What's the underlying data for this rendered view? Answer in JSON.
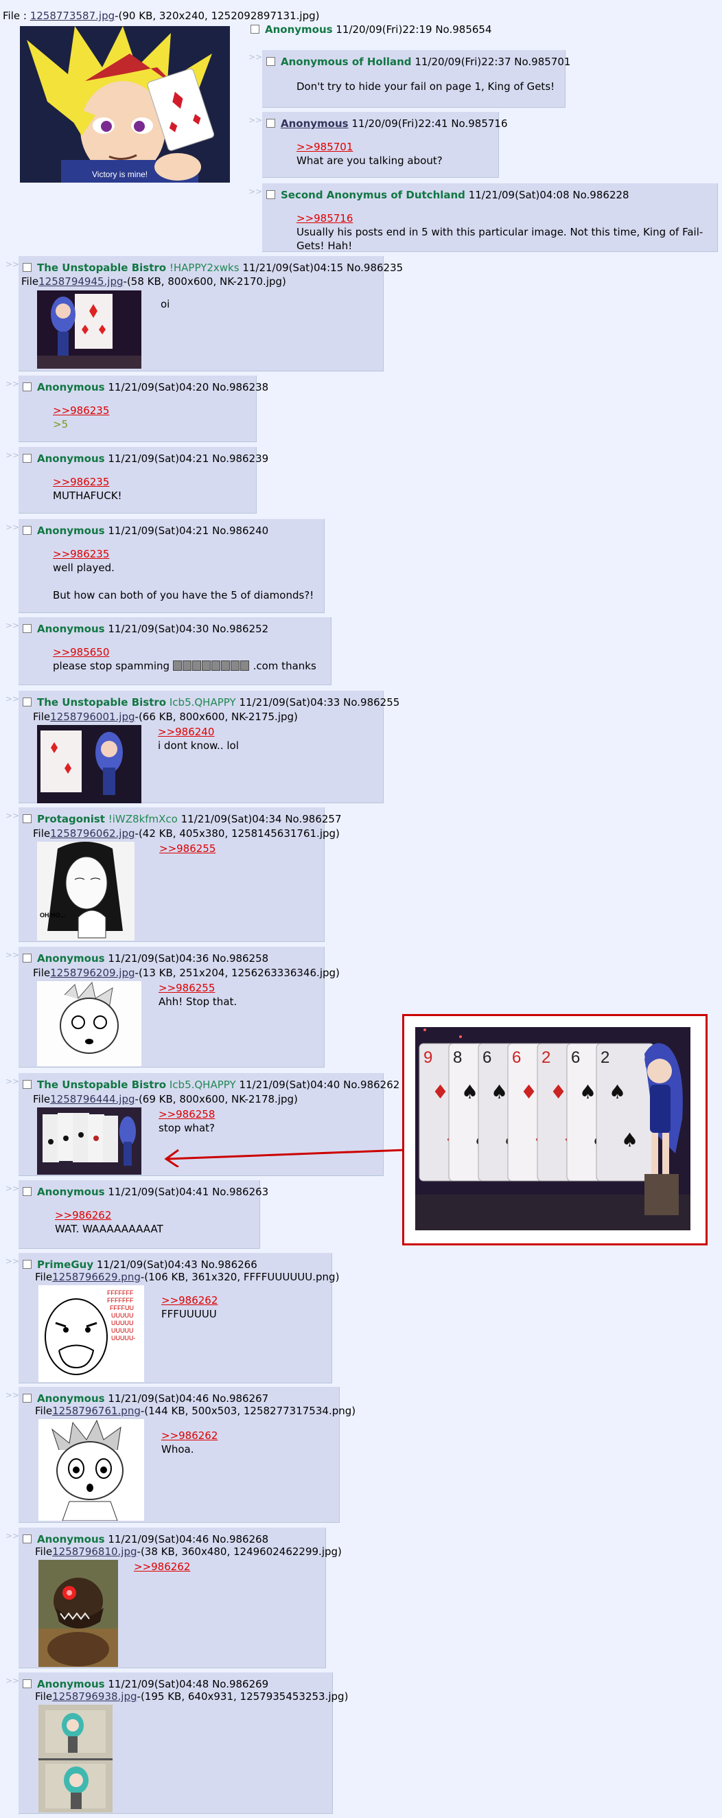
{
  "op": {
    "file_label": "File :",
    "file_link": "1258773587.jpg",
    "file_info": "-(90 KB, 320x240, 1252092897131.jpg)",
    "name": "Anonymous",
    "datetime": "11/20/09(Fri)22:19",
    "no": "No.985654",
    "image_caption": "Victory is mine!"
  },
  "arrows": ">>",
  "posts": [
    {
      "name": "Anonymous of Holland",
      "datetime": "11/20/09(Fri)22:37",
      "no": "No.985701",
      "lines": [
        "Don't try to hide your fail on page 1, King of Gets!"
      ]
    },
    {
      "name": "Anonymous",
      "datetime": "11/20/09(Fri)22:41",
      "no": "No.985716",
      "quote": ">>985701",
      "lines": [
        "What are you talking about?"
      ]
    },
    {
      "name": "Second Anonymus of Dutchland",
      "datetime": "11/21/09(Sat)04:08",
      "no": "No.986228",
      "quote": ">>985716",
      "lines": [
        "Usually his posts end in 5 with this particular image. Not this time, King of Fail-Gets! Hah!"
      ]
    },
    {
      "name": "The Unstopable Bistro",
      "trip": "!HAPPY2xwks",
      "datetime": "11/21/09(Sat)04:15",
      "no": "No.986235",
      "file_label": "File",
      "file_link": "1258794945.jpg",
      "file_info": "-(58 KB, 800x600, NK-2170.jpg)",
      "lines": [
        "oi"
      ]
    },
    {
      "name": "Anonymous",
      "datetime": "11/21/09(Sat)04:20",
      "no": "No.986238",
      "quote": ">>986235",
      "greentext": ">5"
    },
    {
      "name": "Anonymous",
      "datetime": "11/21/09(Sat)04:21",
      "no": "No.986239",
      "quote": ">>986235",
      "lines": [
        "MUTHAFUCK!"
      ]
    },
    {
      "name": "Anonymous",
      "datetime": "11/21/09(Sat)04:21",
      "no": "No.986240",
      "quote": ">>986235",
      "lines": [
        "well played.",
        "",
        "But how can both of you have the 5 of diamonds?!"
      ]
    },
    {
      "name": "Anonymous",
      "datetime": "11/21/09(Sat)04:30",
      "no": "No.986252",
      "quote": ">>985650",
      "spam_before": "please stop spamming",
      "spam_after": ".com thanks"
    },
    {
      "name": "The Unstopable Bistro",
      "trip": "Icb5.QHAPPY",
      "datetime": "11/21/09(Sat)04:33",
      "no": "No.986255",
      "file_label": "File",
      "file_link": "1258796001.jpg",
      "file_info": "-(66 KB, 800x600, NK-2175.jpg)",
      "quote": ">>986240",
      "lines": [
        "i dont know.. lol"
      ]
    },
    {
      "name": "Protagonist",
      "trip": "!iWZ8kfmXco",
      "datetime": "11/21/09(Sat)04:34",
      "no": "No.986257",
      "file_label": "File",
      "file_link": "1258796062.jpg",
      "file_info": "-(42 KB, 405x380, 1258145631761.jpg)",
      "quote": ">>986255",
      "image_caption": "OH HO..."
    },
    {
      "name": "Anonymous",
      "datetime": "11/21/09(Sat)04:36",
      "no": "No.986258",
      "file_label": "File",
      "file_link": "1258796209.jpg",
      "file_info": "-(13 KB, 251x204, 1256263336346.jpg)",
      "quote": ">>986255",
      "lines": [
        "Ahh! Stop that."
      ]
    },
    {
      "name": "The Unstopable Bistro",
      "trip": "Icb5.QHAPPY",
      "datetime": "11/21/09(Sat)04:40",
      "no": "No.986262",
      "file_label": "File",
      "file_link": "1258796444.jpg",
      "file_info": "-(69 KB, 800x600, NK-2178.jpg)",
      "quote": ">>986258",
      "lines": [
        "stop what?"
      ]
    },
    {
      "name": "Anonymous",
      "datetime": "11/21/09(Sat)04:41",
      "no": "No.986263",
      "quote": ">>986262",
      "lines": [
        "WAT. WAAAAAAAAAT"
      ]
    },
    {
      "name": "PrimeGuy",
      "datetime": "11/21/09(Sat)04:43",
      "no": "No.986266",
      "file_label": "File",
      "file_link": "1258796629.png",
      "file_info": "-(106 KB, 361x320, FFFFUUUUUU.png)",
      "quote": ">>986262",
      "lines": [
        "FFFUUUUU"
      ],
      "image_text": "FFFFFFF\nFFFFFFF\nFFFFUU\nUUUUU\nUUUUU\nUUUUU\nUUUUU-"
    },
    {
      "name": "Anonymous",
      "datetime": "11/21/09(Sat)04:46",
      "no": "No.986267",
      "file_label": "File",
      "file_link": "1258796761.png",
      "file_info": "-(144 KB, 500x503, 1258277317534.png)",
      "quote": ">>986262",
      "lines": [
        "Whoa."
      ]
    },
    {
      "name": "Anonymous",
      "datetime": "11/21/09(Sat)04:46",
      "no": "No.986268",
      "file_label": "File",
      "file_link": "1258796810.jpg",
      "file_info": "-(38 KB, 360x480, 1249602462299.jpg)",
      "quote": ">>986262"
    },
    {
      "name": "Anonymous",
      "datetime": "11/21/09(Sat)04:48",
      "no": "No.986269",
      "file_label": "File",
      "file_link": "1258796938.jpg",
      "file_info": "-(195 KB, 640x931, 1257935453253.jpg)"
    }
  ],
  "callout": {
    "cards": [
      "9",
      "8",
      "6",
      "6",
      "2",
      "6",
      "2"
    ]
  },
  "colors": {
    "name_green": "#117743",
    "quote_red": "#dd0000",
    "link_navy": "#34345c",
    "reply_bg": "#d6daf0",
    "page_bg": "#eef2ff",
    "annotation_red": "#cc0000"
  }
}
